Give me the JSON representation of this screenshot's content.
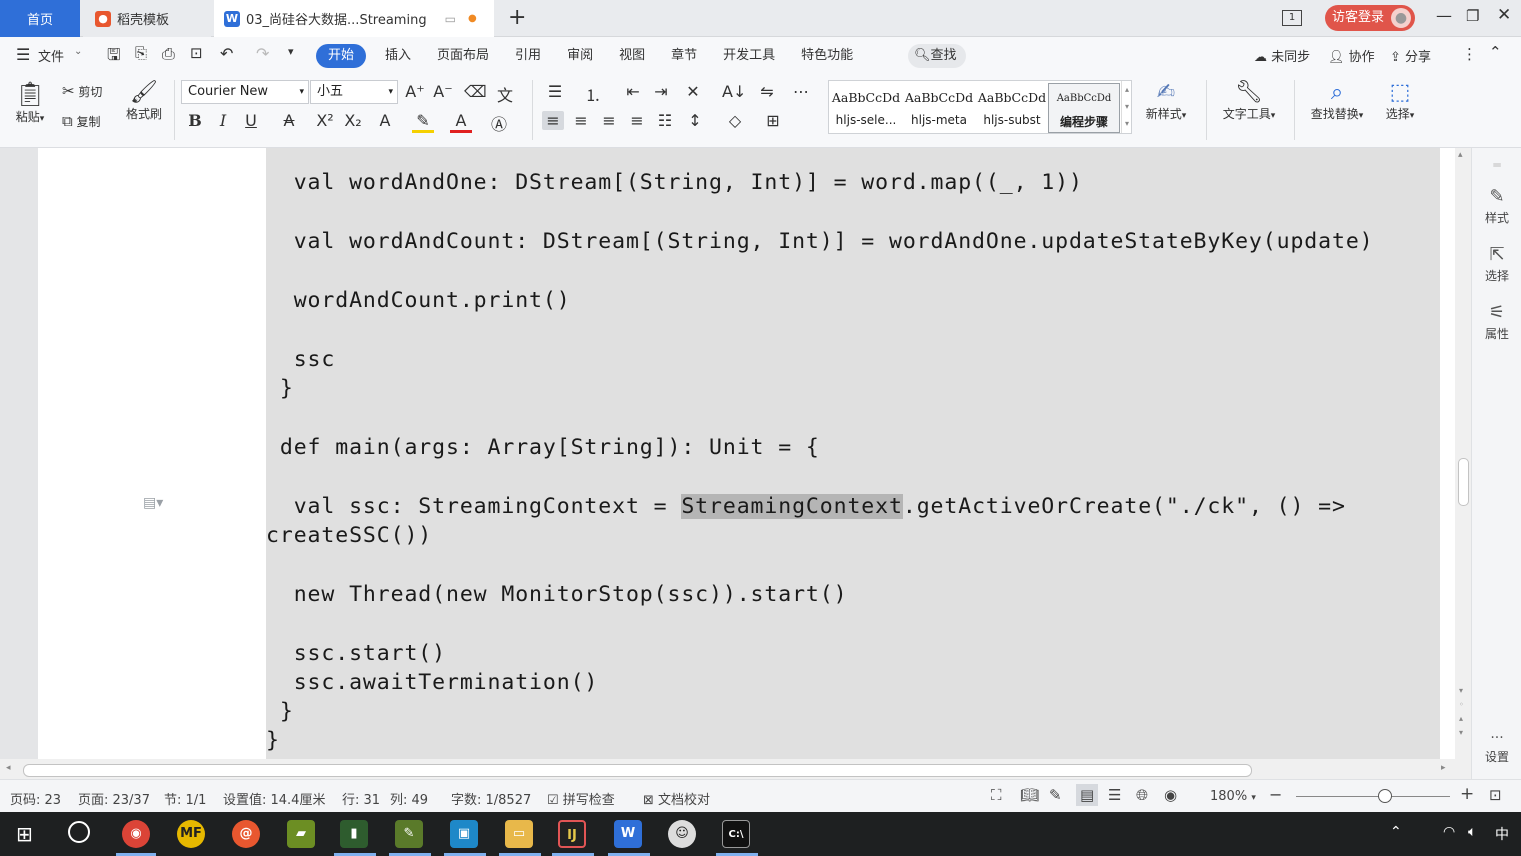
{
  "tabs": {
    "home": "首页",
    "template": "稻壳模板",
    "doc_title": "03_尚硅谷大数据...Streaming",
    "new_tab": "+",
    "page_indicator": "1",
    "login": "访客登录"
  },
  "menu": {
    "file": "文件",
    "items": [
      "开始",
      "插入",
      "页面布局",
      "引用",
      "审阅",
      "视图",
      "章节",
      "开发工具",
      "特色功能"
    ],
    "search": "查找",
    "sync": "未同步",
    "collab": "协作",
    "share": "分享"
  },
  "ribbon": {
    "paste": "粘贴",
    "cut": "剪切",
    "copy": "复制",
    "format_painter": "格式刷",
    "font_name": "Courier New",
    "font_size": "小五",
    "styles": [
      {
        "preview": "AaBbCcDd",
        "name": "hljs-sele..."
      },
      {
        "preview": "AaBbCcDd",
        "name": "hljs-meta"
      },
      {
        "preview": "AaBbCcDd",
        "name": "hljs-subst"
      },
      {
        "preview": "AaBbCcDd",
        "name": "编程步骤"
      }
    ],
    "new_style": "新样式",
    "text_tools": "文字工具",
    "find_replace": "查找替换",
    "select": "选择"
  },
  "code": {
    "l1": "  val wordAndOne: DStream[(String, Int)] = word.map((_, 1))",
    "l2": "  val wordAndCount: DStream[(String, Int)] = wordAndOne.updateStateByKey(update)",
    "l3": "  wordAndCount.print()",
    "l4": "  ssc",
    "l5": " }",
    "l6": " def main(args: Array[String]): Unit = {",
    "l7a": "  val ssc: StreamingContext = ",
    "l7b": "StreamingContext",
    "l7c": ".getActiveOrCreate(\"./ck\", () =>",
    "l8": "createSSC())",
    "l9": "  new Thread(new MonitorStop(ssc)).start()",
    "l10": "  ssc.start()",
    "l11": "  ssc.awaitTermination()",
    "l12": " }",
    "l13": "}"
  },
  "right_panel": {
    "style": "样式",
    "select": "选择",
    "properties": "属性",
    "settings": "设置"
  },
  "status": {
    "page_code": "页码: 23",
    "page": "页面: 23/37",
    "section": "节: 1/1",
    "position": "设置值: 14.4厘米",
    "row": "行: 31",
    "col": "列: 49",
    "words": "字数: 1/8527",
    "spell": "拼写检查",
    "proof": "文档校对",
    "zoom": "180%"
  },
  "taskbar": {
    "ime": "中"
  },
  "colors": {
    "accent": "#2f6fd8",
    "login": "#e0554a",
    "code_bg": "#e0e0e0",
    "taskbar": "#1e2021"
  }
}
